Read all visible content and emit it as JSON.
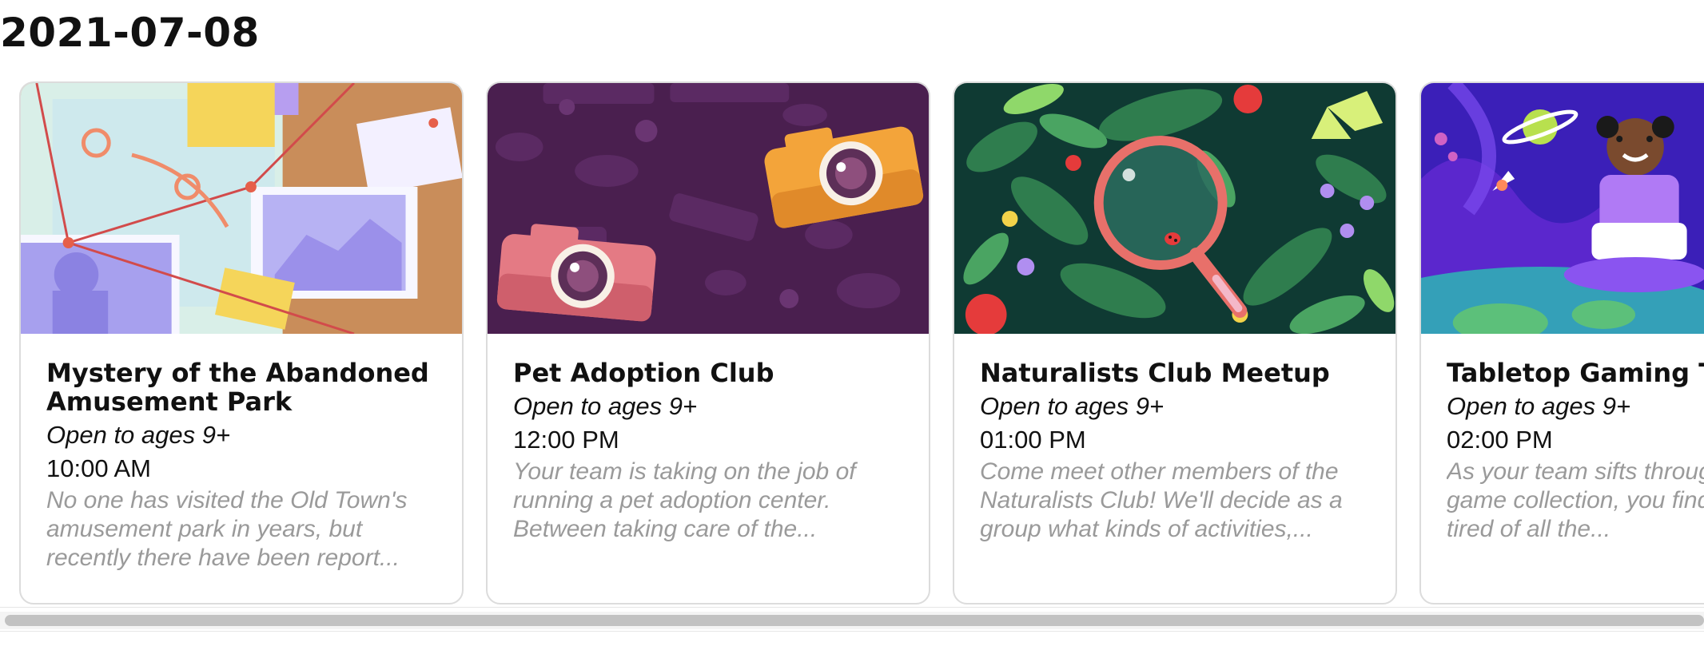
{
  "section": {
    "date": "2021-07-08"
  },
  "colors": {
    "card_border": "#dcdcdc",
    "description": "#9a9a9a",
    "scrollbar": "#c2c2c2"
  },
  "cards": [
    {
      "title": "Mystery of the Abandoned Amusement Park",
      "ages": "Open to ages 9+",
      "time": "10:00 AM",
      "description": "No one has visited the Old Town's amusement park in years, but recently there have been report...",
      "image_icon": "mystery-evidence-board-illustration"
    },
    {
      "title": "Pet Adoption Club",
      "ages": "Open to ages 9+",
      "time": "12:00 PM",
      "description": "Your team is taking on the job of running a pet adoption center. Between taking care of the...",
      "image_icon": "cameras-illustration"
    },
    {
      "title": "Naturalists Club Meetup",
      "ages": "Open to ages 9+",
      "time": "01:00 PM",
      "description": "Come meet other members of the Naturalists Club! We'll decide as a group what kinds of activities,...",
      "image_icon": "magnifying-glass-nature-illustration"
    },
    {
      "title": "Tabletop Gaming Tycoon",
      "ages": "Open to ages 9+",
      "time": "02:00 PM",
      "description": "As your team sifts through the board game collection, you find yourself tired of all the...",
      "image_icon": "space-girl-gaming-illustration"
    }
  ]
}
